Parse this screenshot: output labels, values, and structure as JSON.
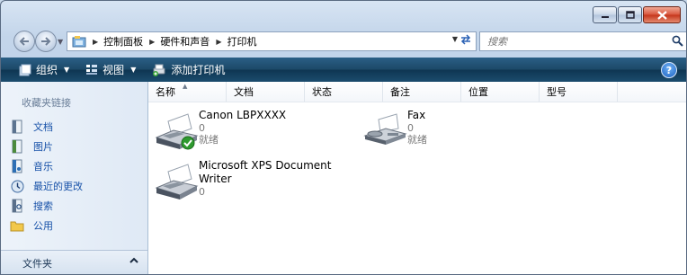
{
  "address": {
    "crumbs": [
      "控制面板",
      "硬件和声音",
      "打印机"
    ]
  },
  "search": {
    "placeholder": "搜索"
  },
  "toolbar": {
    "organize": "组织",
    "views": "视图",
    "add_printer": "添加打印机",
    "help": "?"
  },
  "navpane": {
    "title": "收藏夹链接",
    "links": [
      {
        "label": "文档",
        "icon": "documents-icon"
      },
      {
        "label": "图片",
        "icon": "pictures-icon"
      },
      {
        "label": "音乐",
        "icon": "music-icon"
      },
      {
        "label": "最近的更改",
        "icon": "recent-changes-icon"
      },
      {
        "label": "搜索",
        "icon": "searches-icon"
      },
      {
        "label": "公用",
        "icon": "public-folder-icon"
      }
    ],
    "folders_label": "文件夹"
  },
  "columns": [
    "名称",
    "文档",
    "状态",
    "备注",
    "位置",
    "型号"
  ],
  "printers": [
    {
      "name": "Canon LBPXXXX",
      "docs": "0",
      "status": "就绪",
      "default": true,
      "icon": "printer-icon"
    },
    {
      "name": "Fax",
      "docs": "0",
      "status": "就绪",
      "default": false,
      "icon": "fax-icon"
    },
    {
      "name_line1": "Microsoft XPS Document",
      "name_line2": "Writer",
      "docs": "0",
      "default": false,
      "icon": "printer-icon"
    }
  ],
  "colors": {
    "toolbar": "#1c4968",
    "link": "#1751a8",
    "window_frame": "#c3d5ea"
  }
}
